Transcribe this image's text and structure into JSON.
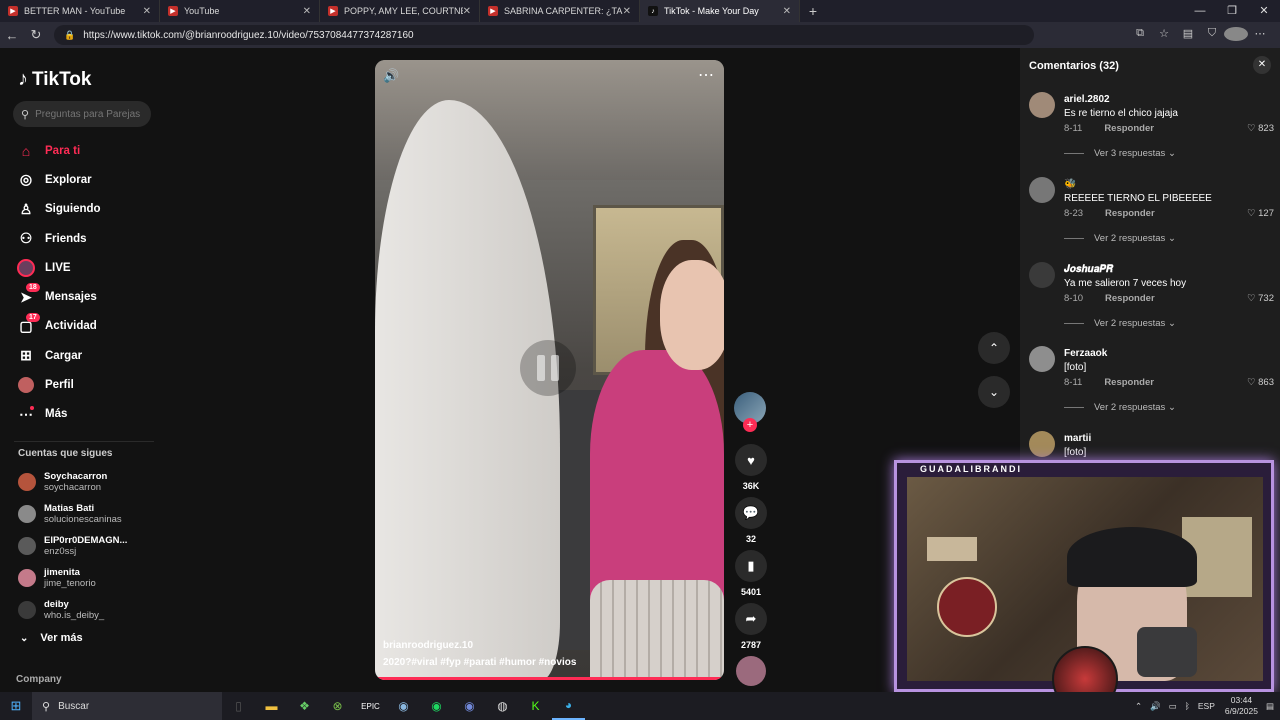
{
  "browser": {
    "tabs": [
      {
        "title": "BETTER MAN - YouTube",
        "icon": "youtube-icon"
      },
      {
        "title": "YouTube",
        "icon": "youtube-icon"
      },
      {
        "title": "POPPY, AMY LEE, COURTNEY LAF",
        "icon": "youtube-icon"
      },
      {
        "title": "SABRINA CARPENTER: ¿TALENTO",
        "icon": "youtube-icon"
      },
      {
        "title": "TikTok - Make Your Day",
        "icon": "tiktok-icon",
        "active": true
      }
    ],
    "url": "https://www.tiktok.com/@brianroodriguez.10/video/7537084477374287160"
  },
  "sidebar": {
    "logo": "TikTok",
    "search_placeholder": "Preguntas para Parejas",
    "menu": [
      {
        "label": "Para ti",
        "icon": "home-icon",
        "active": true
      },
      {
        "label": "Explorar",
        "icon": "compass-icon"
      },
      {
        "label": "Siguiendo",
        "icon": "user-follow-icon"
      },
      {
        "label": "Friends",
        "icon": "friends-icon"
      },
      {
        "label": "LIVE",
        "icon": "live-icon"
      },
      {
        "label": "Mensajes",
        "icon": "message-icon",
        "badge": "18"
      },
      {
        "label": "Actividad",
        "icon": "activity-icon",
        "badge": "17"
      },
      {
        "label": "Cargar",
        "icon": "upload-icon"
      },
      {
        "label": "Perfil",
        "icon": "profile-icon"
      },
      {
        "label": "Más",
        "icon": "more-icon"
      }
    ],
    "following_title": "Cuentas que sigues",
    "following": [
      {
        "name": "Soychacarron",
        "user": "soychacarron"
      },
      {
        "name": "Matias Bati",
        "user": "solucionescaninas"
      },
      {
        "name": "ElP0rr0DEMAGN...",
        "user": "enz0ssj"
      },
      {
        "name": "jimenita",
        "user": "jime_tenorio"
      },
      {
        "name": "deiby",
        "user": "who.is_deiby_"
      }
    ],
    "see_more": "Ver más",
    "company": "Company"
  },
  "video": {
    "author": "brianroodriguez.10",
    "caption": "2020?#viral #fyp #parati #humor #novios"
  },
  "actions": {
    "likes": "36K",
    "comments": "32",
    "saves": "5401",
    "shares": "2787"
  },
  "comments": {
    "title": "Comentarios (32)",
    "items": [
      {
        "user": "ariel.2802",
        "text": "Es re tierno el chico jajaja",
        "date": "8-11",
        "reply": "Responder",
        "likes": "823",
        "replies": "Ver 3 respuestas"
      },
      {
        "user": "",
        "text": "REEEEE TIERNO EL PIBEEEEE",
        "date": "8-23",
        "reply": "Responder",
        "likes": "127",
        "replies": "Ver 2 respuestas"
      },
      {
        "user": "𝑱𝒐𝒔𝒉𝒖𝒂𝑷𝑹",
        "text": "Ya me salieron 7 veces hoy",
        "date": "8-10",
        "reply": "Responder",
        "likes": "732",
        "replies": "Ver 2 respuestas"
      },
      {
        "user": "Ferzaaok",
        "text": "[foto]",
        "date": "8-11",
        "reply": "Responder",
        "likes": "863",
        "replies": "Ver 2 respuestas"
      },
      {
        "user": "martii",
        "text": "[foto]",
        "date": "",
        "reply": "",
        "likes": "",
        "replies": ""
      }
    ]
  },
  "webcam": {
    "label": "GUADALIBRANDI"
  },
  "taskbar": {
    "search": "Buscar",
    "lang": "ESP",
    "time": "03:44",
    "date": "6/9/2025"
  }
}
